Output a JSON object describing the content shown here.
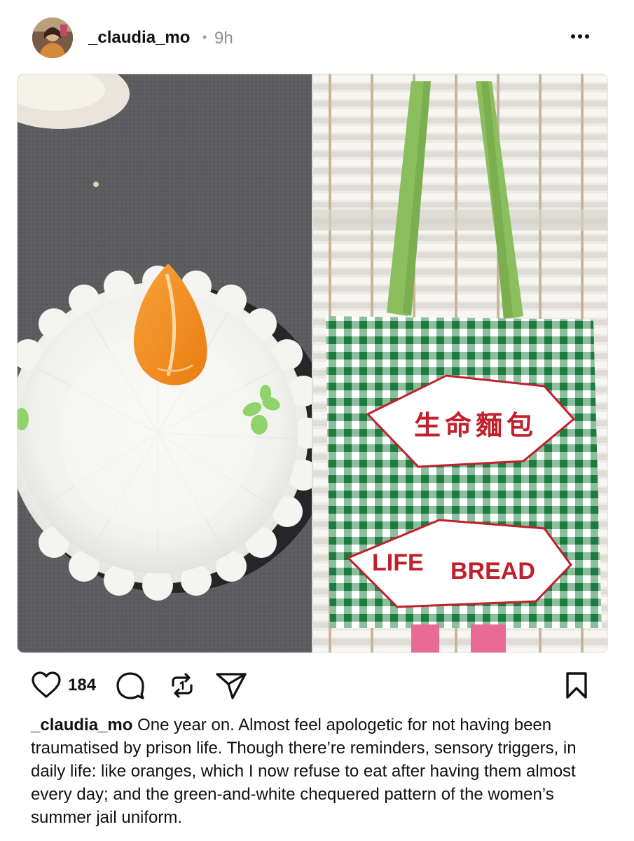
{
  "post": {
    "username": "_claudia_mo",
    "separator": "•",
    "time": "9h",
    "more_label": "•••",
    "like_count": "184",
    "caption_user": "_claudia_mo",
    "caption_text": "One year on. Almost feel apologetic for not having been traumatised by prison life. Though there’re reminders, sensory triggers, in daily life: like oranges, which I now refuse to eat after having them almost every day; and the green-and-white chequered pattern of the women’s summer jail uniform."
  },
  "media": {
    "bag_label_chinese": "生命麵包",
    "bag_label_life": "LIFE",
    "bag_label_bread": "BREAD"
  },
  "icons": {
    "avatar": "profile-photo",
    "more": "more-horizontal-icon",
    "like": "heart-icon",
    "comment": "comment-bubble-icon",
    "repost": "repost-icon",
    "share": "send-paper-plane-icon",
    "save": "bookmark-icon"
  },
  "colors": {
    "gingham_green": "#2e8b4e",
    "strap_green": "#8bbf5e",
    "label_red": "#c0202c",
    "orange": "#f08a1c"
  }
}
